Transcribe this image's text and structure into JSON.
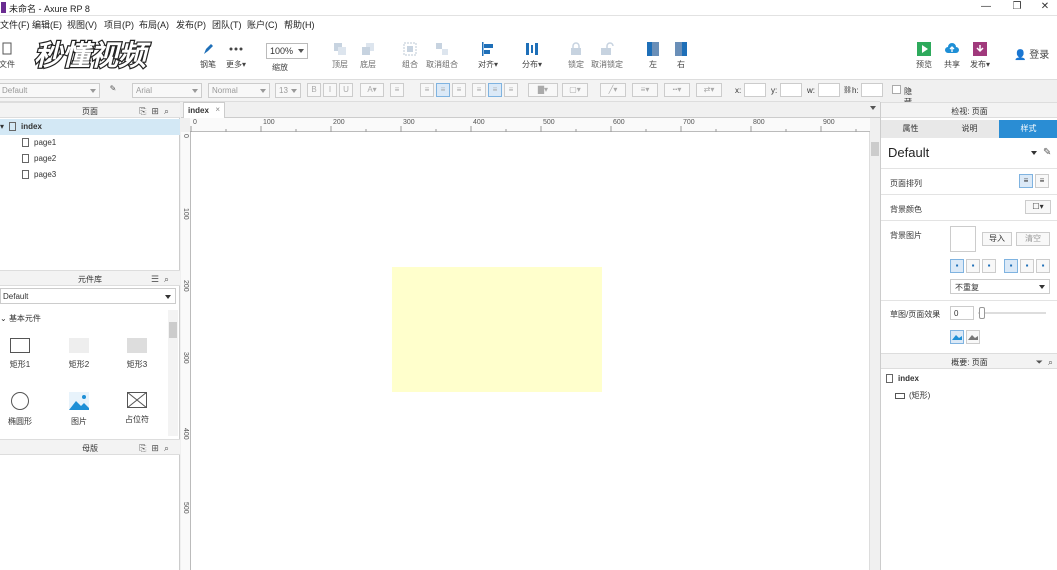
{
  "window": {
    "title": "未命名 - Axure RP 8",
    "minimize": "—",
    "restore": "❐",
    "close": "✕"
  },
  "menu": [
    "文件(F)",
    "编辑(E)",
    "视图(V)",
    "项目(P)",
    "布局(A)",
    "发布(P)",
    "团队(T)",
    "账户(C)",
    "帮助(H)"
  ],
  "toolbar": {
    "file_label": "文件",
    "pen_label": "钢笔",
    "more_label": "更多▾",
    "zoom_value": "100%",
    "zoom_label": "缩放",
    "top_label": "顶层",
    "bottom_label": "底层",
    "group_label": "组合",
    "ungroup_label": "取消组合",
    "align_label": "对齐▾",
    "distribute_label": "分布▾",
    "lock_label": "锁定",
    "unlock_label": "取消锁定",
    "left_label": "左",
    "right_label": "右",
    "preview_label": "预览",
    "share_label": "共享",
    "publish_label": "发布▾",
    "login_label": "登录"
  },
  "watermark": {
    "text": "秒懂视频"
  },
  "format_bar": {
    "style_value": "Default",
    "font_value": "Arial",
    "weight_value": "Normal",
    "size_value": "13",
    "x_label": "x:",
    "y_label": "y:",
    "w_label": "w:",
    "h_label": "h:",
    "hidden_label": "隐藏"
  },
  "pages_panel": {
    "title": "页面",
    "items": [
      {
        "label": "index",
        "selected": true
      },
      {
        "label": "page1"
      },
      {
        "label": "page2"
      },
      {
        "label": "page3"
      }
    ]
  },
  "library_panel": {
    "title": "元件库",
    "selected_library": "Default",
    "section": "基本元件",
    "widgets": [
      "矩形1",
      "矩形2",
      "矩形3",
      "椭圆形",
      "图片",
      "占位符"
    ]
  },
  "masters_panel": {
    "title": "母版"
  },
  "canvas": {
    "tab_label": "index",
    "tab_close": "×",
    "ruler_h": [
      "0",
      "100",
      "200",
      "300",
      "400",
      "500",
      "600",
      "700",
      "800",
      "900"
    ],
    "ruler_v": [
      "0",
      "100",
      "200",
      "300",
      "400",
      "500"
    ],
    "rect_color": "#ffffcc"
  },
  "inspector": {
    "title": "检视: 页面",
    "tabs": [
      "属性",
      "说明",
      "样式"
    ],
    "active_tab": "样式",
    "style_name": "Default",
    "page_align_label": "页面排列",
    "bg_color_label": "背景颜色",
    "bg_image_label": "背景图片",
    "import_label": "导入",
    "clear_label": "清空",
    "repeat_value": "不重复",
    "sketch_label": "草图/页面效果",
    "sketch_value": "0"
  },
  "outline_panel": {
    "title": "概要: 页面",
    "root": "index",
    "child": "(矩形)"
  },
  "colors": {
    "accent": "#2a8dd4",
    "selection": "#d3e8f5"
  }
}
